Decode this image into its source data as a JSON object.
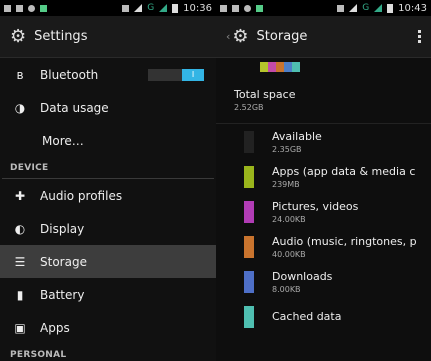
{
  "left": {
    "status_time": "10:36",
    "title": "Settings",
    "items": [
      {
        "label": "Bluetooth",
        "icon": "bluetooth-icon",
        "toggle": "I"
      },
      {
        "label": "Data usage",
        "icon": "data-usage-icon"
      },
      {
        "label": "More…"
      }
    ],
    "section_device": "DEVICE",
    "device_items": [
      {
        "label": "Audio profiles",
        "icon": "audio-profiles-icon"
      },
      {
        "label": "Display",
        "icon": "display-icon"
      },
      {
        "label": "Storage",
        "icon": "storage-icon",
        "selected": true
      },
      {
        "label": "Battery",
        "icon": "battery-icon"
      },
      {
        "label": "Apps",
        "icon": "apps-icon"
      }
    ],
    "section_personal": "PERSONAL"
  },
  "right": {
    "status_time": "10:43",
    "title": "Storage",
    "usage_colors": [
      "#b5c42c",
      "#c44ba8",
      "#c9742e",
      "#4e7fc7",
      "#4fbfb1"
    ],
    "total_label": "Total space",
    "total_value": "2.52GB",
    "rows": [
      {
        "name": "Available",
        "value": "2.35GB",
        "color": "#222222"
      },
      {
        "name": "Apps (app data & media c",
        "value": "239MB",
        "color": "#9ab51c"
      },
      {
        "name": "Pictures, videos",
        "value": "24.00KB",
        "color": "#b13cb5"
      },
      {
        "name": "Audio (music, ringtones, p",
        "value": "40.00KB",
        "color": "#c9742e"
      },
      {
        "name": "Downloads",
        "value": "8.00KB",
        "color": "#4e6fc7"
      },
      {
        "name": "Cached data",
        "value": "",
        "color": "#4fbfb1"
      }
    ]
  }
}
